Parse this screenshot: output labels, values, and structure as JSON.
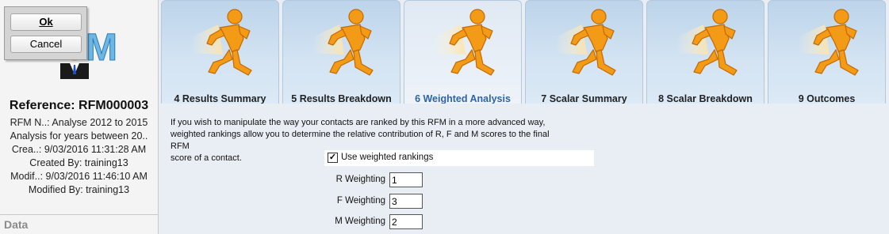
{
  "dialog": {
    "ok_label": "Ok",
    "cancel_label": "Cancel"
  },
  "record": {
    "reference": "Reference: RFM000003",
    "rfm_name": "RFM N..: Analyse 2012 to 2015",
    "analysis": "Analysis for years between 20..",
    "created": "Crea..: 9/03/2016 11:31:28 AM",
    "created_by": "Created By: training13",
    "modified": "Modif..: 9/03/2016 11:46:10 AM",
    "modified_by": "Modified By: training13"
  },
  "data_section": "Data",
  "tabs": [
    {
      "label": "4 Results Summary",
      "active": false
    },
    {
      "label": "5 Results Breakdown",
      "active": false
    },
    {
      "label": "6 Weighted Analysis",
      "active": true
    },
    {
      "label": "7 Scalar Summary",
      "active": false
    },
    {
      "label": "8 Scalar Breakdown",
      "active": false
    },
    {
      "label": "9 Outcomes",
      "active": false
    }
  ],
  "content": {
    "intro_line1": "If you wish to manipulate the way your contacts are ranked by this RFM in a more advanced way,",
    "intro_line2": "weighted rankings allow you to determine the relative contribution of R, F and M scores to the final RFM",
    "intro_line3": "score of a contact.",
    "use_weighted_label": "Use weighted rankings",
    "use_weighted_checked": true,
    "r_label": "R Weighting",
    "r_value": "1",
    "f_label": "F Weighting",
    "f_value": "3",
    "m_label": "M Weighting",
    "m_value": "2"
  },
  "icons": {
    "tab_icon": "running-man-icon",
    "logo": "rfm-logo"
  },
  "colors": {
    "tab_icon": "#f39a17",
    "active_tab_text": "#2d64a8"
  }
}
